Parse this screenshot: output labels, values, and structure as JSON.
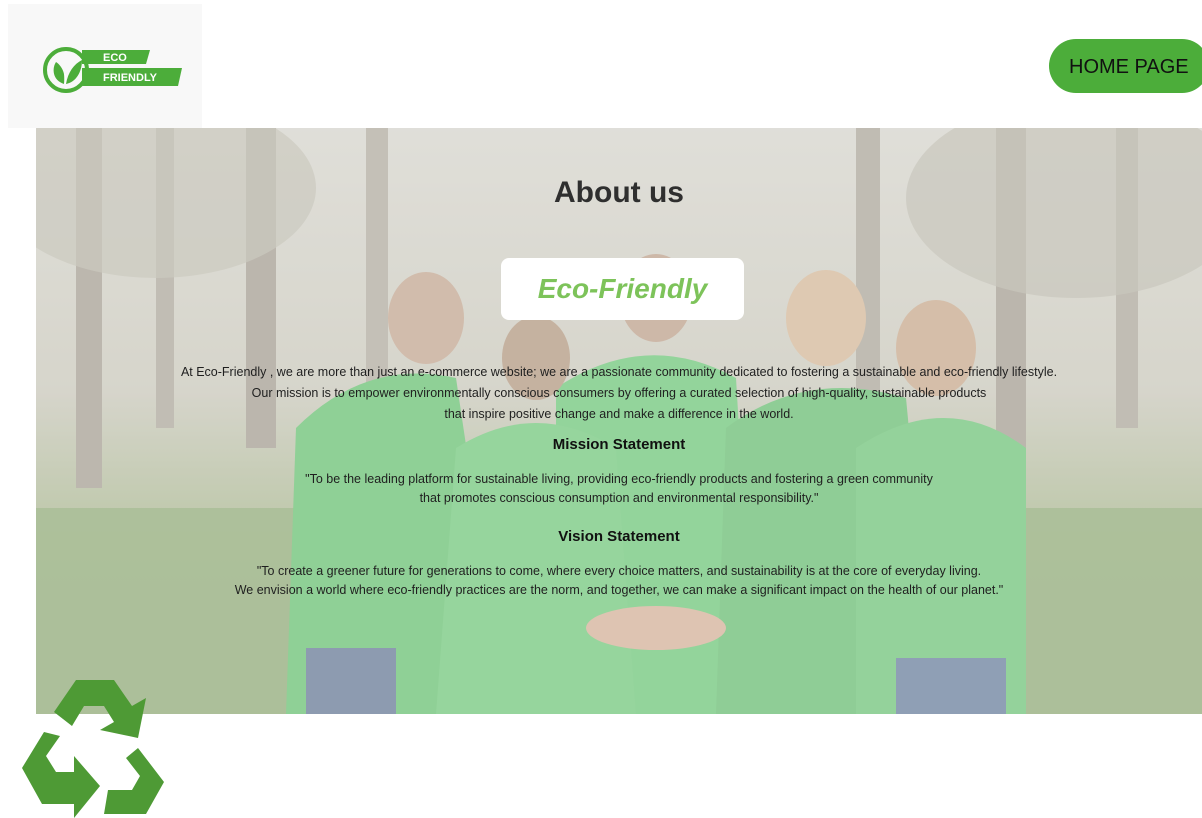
{
  "header": {
    "logo": {
      "line1": "ECO",
      "line2": "FRIENDLY",
      "icon": "leaf-logo-icon"
    },
    "home_button_label": "HOME PAGE"
  },
  "about": {
    "title": "About us",
    "badge": "Eco-Friendly",
    "intro_lines": [
      "At Eco-Friendly , we are more than just an e-commerce website; we are a passionate community dedicated to fostering a sustainable and eco-friendly lifestyle.",
      "Our mission is to empower environmentally conscious consumers by offering a curated selection of high-quality, sustainable products",
      "that inspire positive change and make a difference in the world."
    ],
    "mission": {
      "heading": "Mission Statement",
      "lines": [
        "\"To be the leading platform for sustainable living, providing eco-friendly products and fostering a green community",
        "that promotes conscious consumption and environmental responsibility.\""
      ]
    },
    "vision": {
      "heading": "Vision Statement",
      "lines": [
        "\"To create a greener future for generations to come, where every choice matters, and sustainability is at the core of everyday living.",
        "We envision a world where eco-friendly practices are the norm, and together, we can make a significant impact on the health of our planet.\""
      ]
    }
  },
  "colors": {
    "brand_green": "#4cad3a",
    "badge_text": "#7dc35a",
    "recycle_green": "#4e9a35"
  },
  "decor": {
    "recycle_icon": "recycle-icon"
  }
}
